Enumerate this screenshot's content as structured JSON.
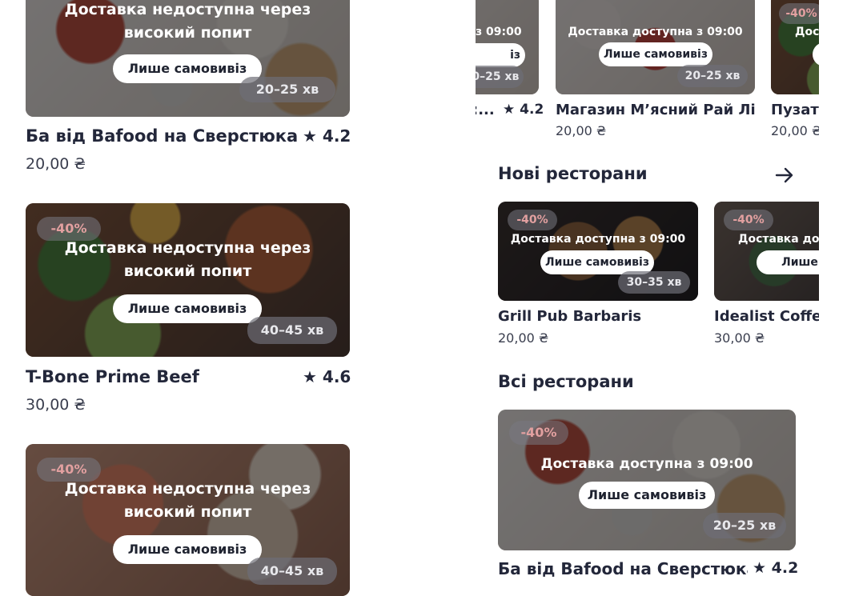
{
  "left_column": {
    "cards": [
      {
        "name": "Ба від Bafood на Сверстюка",
        "rating": "4.2",
        "price": "20,00 ₴",
        "overlay_line1": "Доставка недоступна через",
        "overlay_line2": "високий попит",
        "pill": "Лише самовивіз",
        "time": "20–25 хв"
      },
      {
        "name": "T-Bone Prime Beef",
        "rating": "4.6",
        "price": "30,00 ₴",
        "discount": "-40%",
        "overlay_line1": "Доставка недоступна через",
        "overlay_line2": "високий попит",
        "pill": "Лише самовивіз",
        "time": "40–45 хв"
      },
      {
        "discount": "-40%",
        "overlay_line1": "Доставка недоступна через",
        "overlay_line2": "високий попит",
        "pill": "Лише самовивіз",
        "time": "40–45 хв"
      }
    ]
  },
  "right_column": {
    "top_row": {
      "card_a": {
        "overlay": "з 09:00",
        "pill": "із",
        "time": "20–25 хв",
        "name": ":...",
        "rating": "4.2"
      },
      "card_b": {
        "overlay": "Доставка доступна з 09:00",
        "pill": "Лише самовивіз",
        "time": "20–25 хв",
        "name": "Магазин Мʼясний Рай Лів...",
        "price": "20,00 ₴"
      },
      "card_c": {
        "discount": "-40%",
        "overlay": "Дос",
        "name": "Пузата",
        "price": "20,00 ₴"
      }
    },
    "new_section": {
      "title": "Нові ресторани",
      "cards": [
        {
          "discount": "-40%",
          "overlay": "Доставка доступна з 09:00",
          "pill": "Лише самовивіз",
          "time": "30–35 хв",
          "name": "Grill Pub Barbaris",
          "price": "20,00 ₴"
        },
        {
          "discount": "-40%",
          "overlay": "Доставка доступна з",
          "pill": "Лише сам",
          "name": "Idealist Coffee",
          "price": "30,00 ₴"
        }
      ]
    },
    "all_section": {
      "title": "Всі ресторани",
      "card": {
        "discount": "-40%",
        "overlay": "Доставка доступна з 09:00",
        "pill": "Лише самовивіз",
        "time": "20–25 хв",
        "name": "Ба від Bafood на Сверстюка",
        "rating": "4.2"
      }
    }
  },
  "icons": {
    "star": "star-icon",
    "arrow": "arrow-right-icon"
  }
}
